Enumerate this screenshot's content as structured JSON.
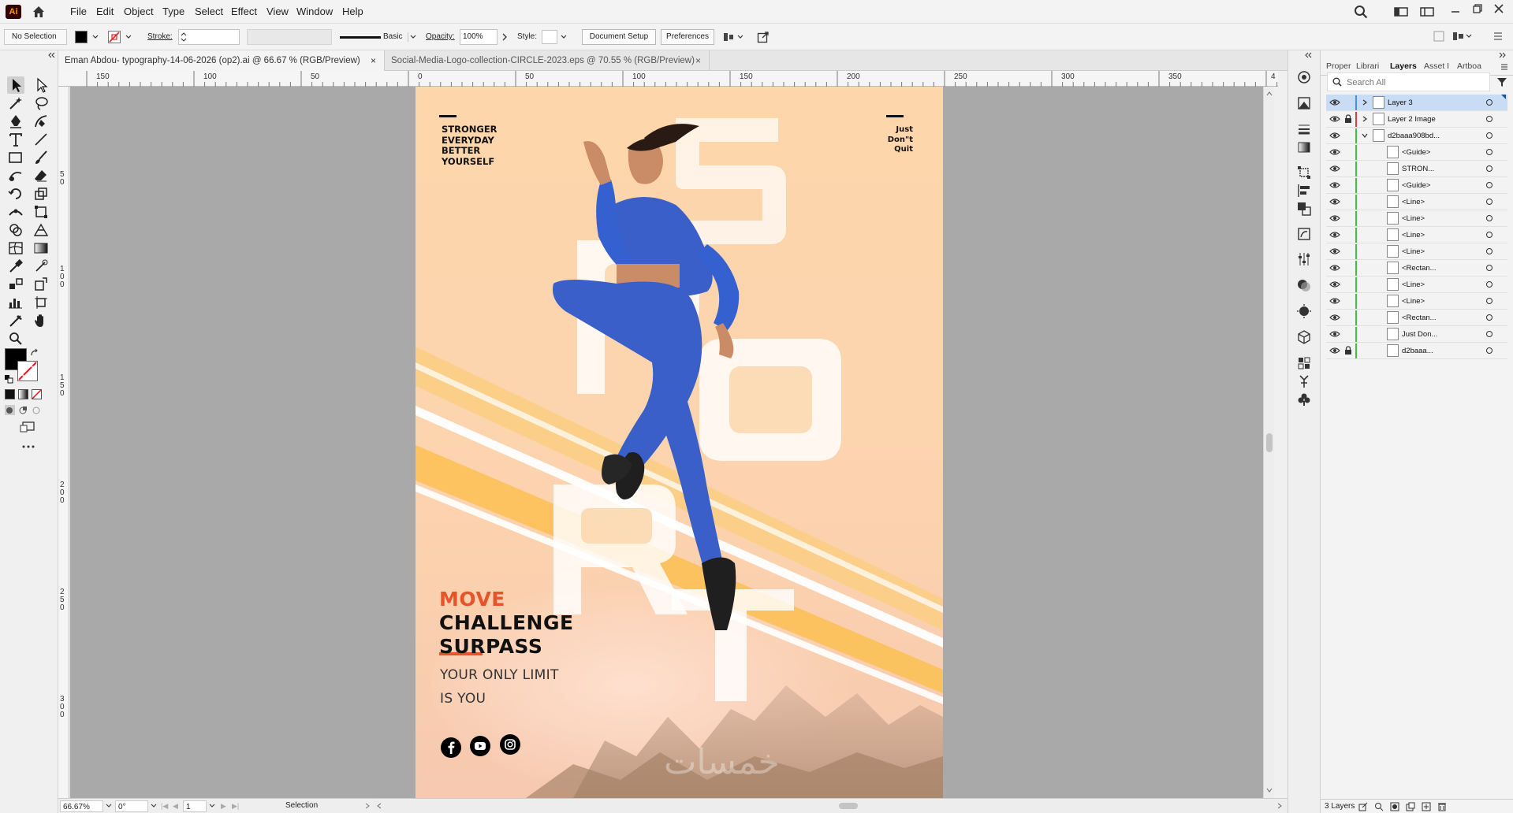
{
  "app": {
    "logo": "Ai",
    "menus": [
      "File",
      "Edit",
      "Object",
      "Type",
      "Select",
      "Effect",
      "View",
      "Window",
      "Help"
    ]
  },
  "control_bar": {
    "selection_label": "No Selection",
    "stroke_label": "Stroke:",
    "brush_label": "Basic",
    "opacity_label": "Opacity:",
    "opacity_value": "100%",
    "style_label": "Style:",
    "document_setup": "Document Setup",
    "preferences": "Preferences"
  },
  "tabs": [
    {
      "title": "Eman Abdou- typography-14-06-2026 (op2).ai @ 66.67 % (RGB/Preview)",
      "active": true
    },
    {
      "title": "Social-Media-Logo-collection-CIRCLE-2023.eps @ 70.55 % (RGB/Preview)",
      "active": false
    }
  ],
  "ruler": {
    "top": [
      "150",
      "100",
      "50",
      "0",
      "50",
      "100",
      "150",
      "200",
      "250",
      "300",
      "350",
      "4"
    ],
    "left": [
      "5",
      "0",
      "1",
      "0",
      "0",
      "1",
      "5",
      "0",
      "2",
      "0",
      "0",
      "2",
      "5",
      "0",
      "3",
      "0",
      "0"
    ]
  },
  "artwork": {
    "tagline_lines": [
      "STRONGER",
      "EVERYDAY",
      "BETTER",
      "YOURSELF"
    ],
    "slogan_lines": [
      "Just",
      "Don\"t",
      "Quit"
    ],
    "sport_letters": [
      "S",
      "P",
      "O",
      "R",
      "T"
    ],
    "headline_accent": "MOVE",
    "headline_lines": [
      "CHALLENGE",
      "SURPASS"
    ],
    "subline_lines": [
      "YOUR ONLY LIMIT",
      "IS YOU"
    ],
    "watermark": "خمسات",
    "social_icons": [
      "facebook-icon",
      "youtube-icon",
      "instagram-icon"
    ],
    "colors": {
      "background": "#fcd8b0",
      "accent": "#e8542a",
      "suit": "#3a5fc8",
      "stripe": "#fbbf52"
    }
  },
  "status": {
    "zoom": "66.67%",
    "rotation": "0°",
    "artboard_number": "1",
    "tool": "Selection"
  },
  "panel": {
    "tabs": [
      "Proper",
      "Librari",
      "Layers",
      "Asset I",
      "Artboa"
    ],
    "active_tab": "Layers",
    "search_placeholder": "Search All",
    "layers": [
      {
        "name": "Layer 3",
        "indent": 0,
        "expand": "right",
        "selected": true,
        "locked": false,
        "color": "#4a90e2"
      },
      {
        "name": "Layer 2 Image",
        "indent": 0,
        "expand": "right",
        "selected": false,
        "locked": true,
        "color": "#e23a3a"
      },
      {
        "name": "d2baaa908bd...",
        "indent": 0,
        "expand": "down",
        "selected": false,
        "locked": false,
        "color": "#3ec23e"
      },
      {
        "name": "<Guide>",
        "indent": 1,
        "expand": "",
        "selected": false,
        "locked": false,
        "color": "#3ec23e"
      },
      {
        "name": "STRON...",
        "indent": 1,
        "expand": "",
        "selected": false,
        "locked": false,
        "color": "#3ec23e"
      },
      {
        "name": "<Guide>",
        "indent": 1,
        "expand": "",
        "selected": false,
        "locked": false,
        "color": "#3ec23e"
      },
      {
        "name": "<Line>",
        "indent": 1,
        "expand": "",
        "selected": false,
        "locked": false,
        "color": "#3ec23e"
      },
      {
        "name": "<Line>",
        "indent": 1,
        "expand": "",
        "selected": false,
        "locked": false,
        "color": "#3ec23e"
      },
      {
        "name": "<Line>",
        "indent": 1,
        "expand": "",
        "selected": false,
        "locked": false,
        "color": "#3ec23e"
      },
      {
        "name": "<Line>",
        "indent": 1,
        "expand": "",
        "selected": false,
        "locked": false,
        "color": "#3ec23e"
      },
      {
        "name": "<Rectan...",
        "indent": 1,
        "expand": "",
        "selected": false,
        "locked": false,
        "color": "#3ec23e"
      },
      {
        "name": "<Line>",
        "indent": 1,
        "expand": "",
        "selected": false,
        "locked": false,
        "color": "#3ec23e"
      },
      {
        "name": "<Line>",
        "indent": 1,
        "expand": "",
        "selected": false,
        "locked": false,
        "color": "#3ec23e"
      },
      {
        "name": "<Rectan...",
        "indent": 1,
        "expand": "",
        "selected": false,
        "locked": false,
        "color": "#3ec23e"
      },
      {
        "name": "Just Don...",
        "indent": 1,
        "expand": "",
        "selected": false,
        "locked": false,
        "color": "#3ec23e"
      },
      {
        "name": "d2baaa...",
        "indent": 1,
        "expand": "",
        "selected": false,
        "locked": true,
        "color": "#3ec23e"
      }
    ],
    "footer_count": "3 Layers"
  }
}
